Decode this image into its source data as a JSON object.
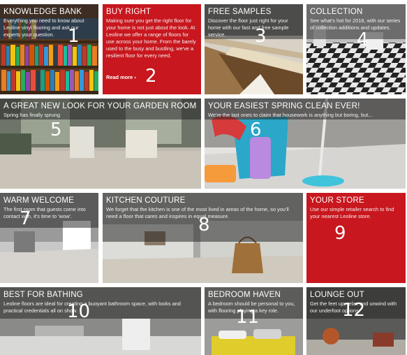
{
  "tiles": [
    {
      "title": "KNOWLEDGE BANK",
      "desc": "Everything you need to know about Leoline vinyl flooring and ask our experts your question.",
      "number": "1"
    },
    {
      "title": "BUY RIGHT",
      "desc": "Making sure you get the right floor for your home is not just about the look. At Leoline we offer a range of floors for use across your home. From the barely used to the busy and bustling, we've a resilient floor for every need.",
      "link": "Read more ›",
      "number": "2"
    },
    {
      "title": "FREE SAMPLES",
      "desc": "Discover the floor just right for your home with our fast and free sample service.",
      "number": "3"
    },
    {
      "title": "COLLECTION",
      "desc": "See what's hot for 2018, with our series of collection additions and updates.",
      "number": "4"
    },
    {
      "title": "A GREAT NEW LOOK FOR YOUR GARDEN ROOM",
      "desc": "Spring has finally sprung",
      "number": "5"
    },
    {
      "title": "YOUR EASIEST SPRING CLEAN EVER!",
      "desc": "We're the last ones to claim that housework is anything but boring, but...",
      "number": "6"
    },
    {
      "title": "WARM WELCOME",
      "desc": "The first room that guests come into contact with, it's time to 'wow'.",
      "number": "7"
    },
    {
      "title": "KITCHEN COUTURE",
      "desc": "We forget that the kitchen is one of the most lived in areas of the home, so you'll need a floor that cares and inspires in equal measure.",
      "number": "8"
    },
    {
      "title": "YOUR STORE",
      "desc": "Use our simple retailer search to find your nearest Leoline store.",
      "number": "9"
    },
    {
      "title": "BEST FOR BATHING",
      "desc": "Leoline floors are ideal for creating a buoyant bathroom space, with looks and practical credentials all on show.",
      "number": "10"
    },
    {
      "title": "BEDROOM HAVEN",
      "desc": "A bedroom should be personal to you, with flooring playing a key role.",
      "number": "11"
    },
    {
      "title": "LOUNGE OUT",
      "desc": "Get the feet up, relax and unwind with our underfoot options.",
      "number": "12"
    }
  ],
  "colors": {
    "brand_red": "#c8171e",
    "overlay": "rgba(35,35,35,0.52)"
  }
}
